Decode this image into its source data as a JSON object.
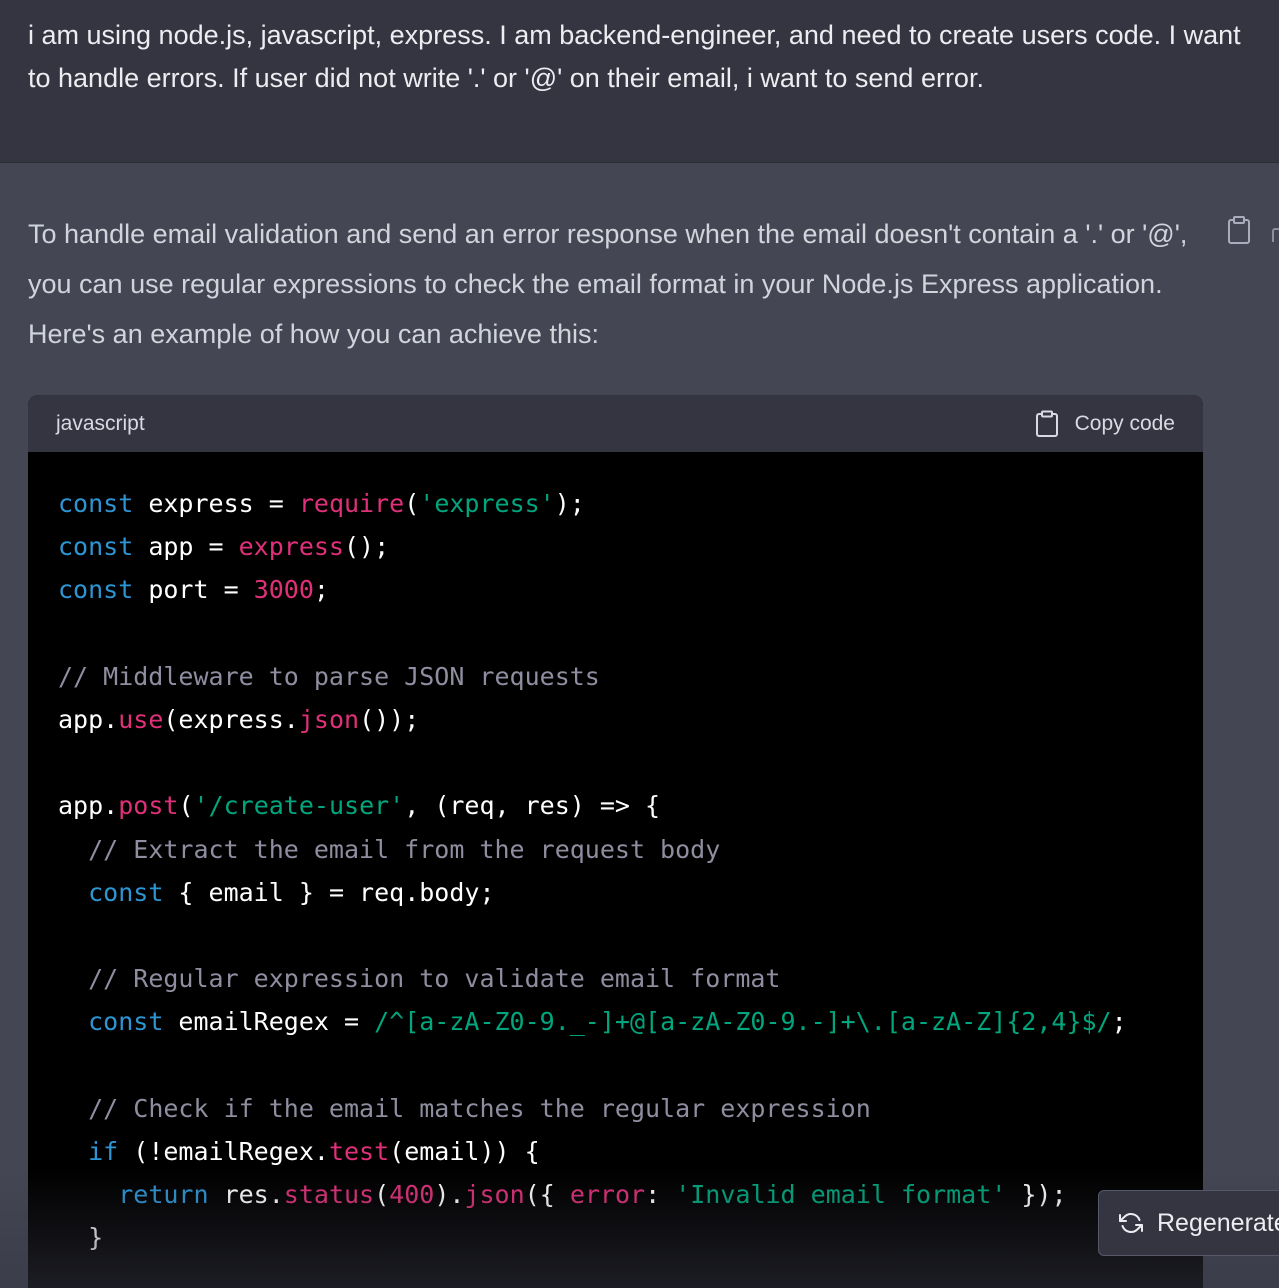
{
  "user_message": {
    "text": "i am using node.js, javascript, express. I am backend-engineer, and need to create users code. I want to handle errors. If user did not write '.' or '@' on their email, i want to send error."
  },
  "assistant_message": {
    "paragraph": "To handle email validation and send an error response when the email doesn't contain a '.' or '@', you can use regular expressions to check the email format in your Node.js Express application. Here's an example of how you can achieve this:",
    "copy_icon": "clipboard-icon"
  },
  "code_block": {
    "language": "javascript",
    "copy_label": "Copy code",
    "copy_icon": "clipboard-icon",
    "lines": [
      "const express = require('express');",
      "const app = express();",
      "const port = 3000;",
      "",
      "// Middleware to parse JSON requests",
      "app.use(express.json());",
      "",
      "app.post('/create-user', (req, res) => {",
      "  // Extract the email from the request body",
      "  const { email } = req.body;",
      "",
      "  // Regular expression to validate email format",
      "  const emailRegex = /^[a-zA-Z0-9._-]+@[a-zA-Z0-9.-]+\\.[a-zA-Z]{2,4}$/;",
      "",
      "  // Check if the email matches the regular expression",
      "  if (!emailRegex.test(email)) {",
      "    return res.status(400).json({ error: 'Invalid email format' });",
      "  }"
    ]
  },
  "regenerate_button": {
    "label": "Regenerate",
    "icon": "refresh-icon"
  },
  "colors": {
    "user_bg": "#343541",
    "assistant_bg": "#444654",
    "code_bg": "#000000",
    "keyword": "#2e95d3",
    "function": "#df3079",
    "string": "#00a67d",
    "comment": "#8e8ea0"
  }
}
